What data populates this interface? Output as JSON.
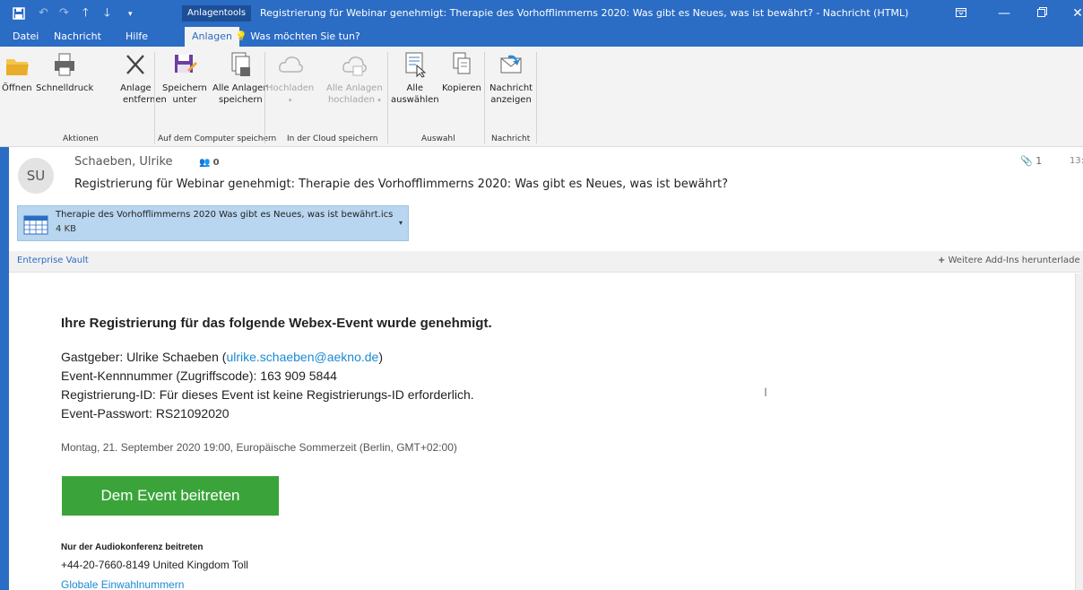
{
  "window": {
    "title": "Registrierung für Webinar genehmigt: Therapie des Vorhofflimmerns 2020: Was gibt es Neues, was ist bewährt?  -  Nachricht (HTML)",
    "context_tools": "Anlagentools"
  },
  "tabs": [
    "Datei",
    "Nachricht",
    "Hilfe",
    "Anlagen"
  ],
  "tell_me": "Was möchten Sie tun?",
  "ribbon": {
    "open": "Öffnen",
    "quick_print": "Schnelldruck",
    "remove_line1": "Anlage",
    "remove_line2": "entfernen",
    "save_as_line1": "Speichern",
    "save_as_line2": "unter",
    "save_all_line1": "Alle Anlagen",
    "save_all_line2": "speichern",
    "upload_line1": "Hochladen",
    "upload_all_line1": "Alle Anlagen",
    "upload_all_line2": "hochladen",
    "select_all_line1": "Alle",
    "select_all_line2": "auswählen",
    "copy": "Kopieren",
    "show_msg_line1": "Nachricht",
    "show_msg_line2": "anzeigen",
    "group_actions": "Aktionen",
    "group_save_computer": "Auf dem Computer speichern",
    "group_save_cloud": "In der Cloud speichern",
    "group_selection": "Auswahl",
    "group_message": "Nachricht"
  },
  "header": {
    "avatar_initials": "SU",
    "sender": "Schaeben, Ulrike",
    "people_count": "0",
    "subject": "Registrierung für Webinar genehmigt: Therapie des Vorhofflimmerns 2020: Was gibt es Neues, was ist bewährt?",
    "attachment_count": "1",
    "time": "13:"
  },
  "attachment": {
    "name": "Therapie des Vorhofflimmerns 2020 Was gibt es Neues, was ist bewährt.ics",
    "size": "4 KB"
  },
  "addin_bar": {
    "enterprise_vault": "Enterprise Vault",
    "more_addins": "Weitere Add-Ins herunterlade"
  },
  "body": {
    "heading": "Ihre Registrierung für das folgende Webex-Event wurde genehmigt.",
    "host_label": "Gastgeber: Ulrike Schaeben (",
    "host_email": "ulrike.schaeben@aekno.de",
    "host_close": ")",
    "event_number": "Event-Kennnummer (Zugriffscode): 163 909 5844",
    "registration_id": "Registrierung-ID: Für dieses Event ist keine Registrierungs-ID erforderlich.",
    "event_password": "Event-Passwort: RS21092020",
    "date": "Montag, 21. September 2020 19:00, Europäische Sommerzeit (Berlin, GMT+02:00)",
    "join_button": "Dem Event beitreten",
    "audio_heading": "Nur der Audiokonferenz beitreten",
    "audio_number": "+44-20-7660-8149 United Kingdom Toll",
    "audio_link": "Globale Einwahlnummern"
  },
  "colors": {
    "brand_blue": "#2b6cc4",
    "join_green": "#3aa43a",
    "link_blue": "#1a8ad4",
    "attachment_bg": "#b8d6ef"
  }
}
